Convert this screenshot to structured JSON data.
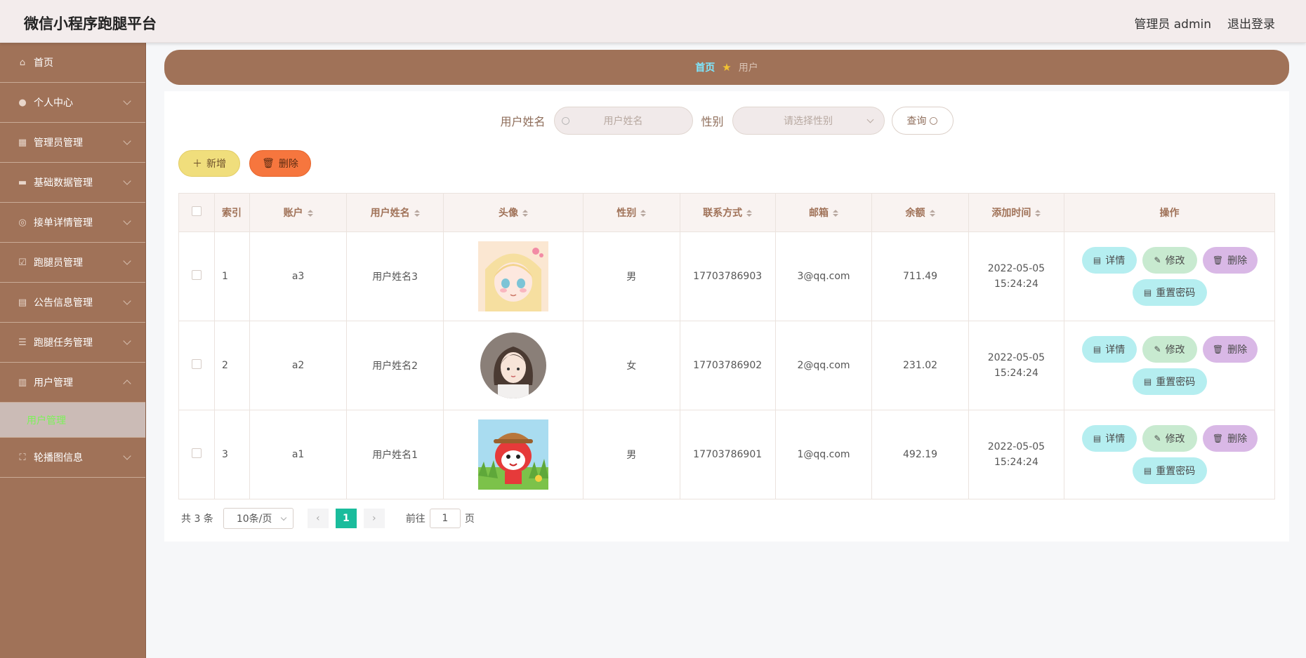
{
  "header": {
    "app_title": "微信小程序跑腿平台",
    "admin_label": "管理员 admin",
    "logout_label": "退出登录"
  },
  "sidebar": {
    "items": [
      {
        "label": "首页",
        "icon": "home-icon"
      },
      {
        "label": "个人中心",
        "icon": "user-icon"
      },
      {
        "label": "管理员管理",
        "icon": "grid-icon"
      },
      {
        "label": "基础数据管理",
        "icon": "database-icon"
      },
      {
        "label": "接单详情管理",
        "icon": "order-icon"
      },
      {
        "label": "跑腿员管理",
        "icon": "checklist-icon"
      },
      {
        "label": "公告信息管理",
        "icon": "briefcase-icon"
      },
      {
        "label": "跑腿任务管理",
        "icon": "sliders-icon"
      },
      {
        "label": "用户管理",
        "icon": "chart-icon"
      },
      {
        "label": "轮播图信息",
        "icon": "fullscreen-icon"
      }
    ],
    "active_sub": "用户管理"
  },
  "breadcrumb": {
    "home": "首页",
    "current": "用户"
  },
  "search": {
    "name_label": "用户姓名",
    "name_placeholder": "用户姓名",
    "gender_label": "性别",
    "gender_placeholder": "请选择性别",
    "query_label": "查询"
  },
  "actions": {
    "add_label": "新增",
    "delete_label": "删除"
  },
  "table": {
    "headers": {
      "index": "索引",
      "account": "账户",
      "name": "用户姓名",
      "avatar": "头像",
      "gender": "性别",
      "phone": "联系方式",
      "email": "邮箱",
      "balance": "余额",
      "created": "添加时间",
      "ops": "操作"
    },
    "rows": [
      {
        "index": "1",
        "account": "a3",
        "name": "用户姓名3",
        "gender": "男",
        "phone": "17703786903",
        "email": "3@qq.com",
        "balance": "711.49",
        "created": "2022-05-05 15:24:24"
      },
      {
        "index": "2",
        "account": "a2",
        "name": "用户姓名2",
        "gender": "女",
        "phone": "17703786902",
        "email": "2@qq.com",
        "balance": "231.02",
        "created": "2022-05-05 15:24:24"
      },
      {
        "index": "3",
        "account": "a1",
        "name": "用户姓名1",
        "gender": "男",
        "phone": "17703786901",
        "email": "1@qq.com",
        "balance": "492.19",
        "created": "2022-05-05 15:24:24"
      }
    ],
    "op_labels": {
      "detail": "详情",
      "edit": "修改",
      "delete": "删除",
      "reset": "重置密码"
    }
  },
  "pagination": {
    "total": "共 3 条",
    "page_size": "10条/页",
    "current_page": "1",
    "goto_label": "前往",
    "goto_value": "1",
    "page_suffix": "页"
  },
  "colors": {
    "sidebar_bg": "#a07258",
    "header_bg": "#f3ecec",
    "active_sub_text": "#7df15a",
    "pager_active": "#1abc9c"
  }
}
